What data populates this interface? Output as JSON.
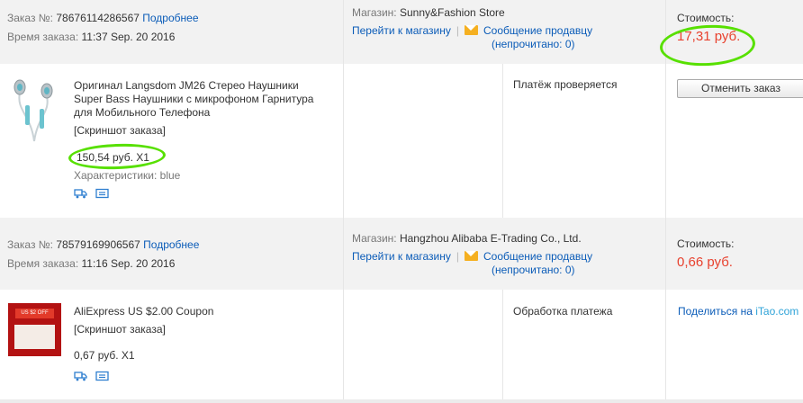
{
  "orders": [
    {
      "order_label": "Заказ №:",
      "order_number": "78676114286567",
      "details_link": "Подробнее",
      "time_label": "Время заказа:",
      "time_value": "11:37 Sep. 20 2016",
      "store_label": "Магазин:",
      "store_name": "Sunny&Fashion Store",
      "go_to_store": "Перейти к магазину",
      "separator": "|",
      "message_seller": "Сообщение продавцу",
      "unread_open": "(непрочитано:",
      "unread_count": "0",
      "unread_close": ")",
      "cost_label": "Стоимость:",
      "cost_value": "17,31 руб.",
      "product_title_1": "Оригинал Langsdom JM26 Стерео Наушники",
      "product_title_2": "Super Bass Наушники с микрофоном Гарнитура",
      "product_title_3": "для Мобильного Телефона",
      "snapshot": "[Скриншот заказа]",
      "item_price": "150,54 руб. X1",
      "attributes_label": "Характеристики:",
      "attributes_value": "blue",
      "status": "Платёж проверяется",
      "action_label": "Отменить заказ"
    },
    {
      "order_label": "Заказ №:",
      "order_number": "78579169906567",
      "details_link": "Подробнее",
      "time_label": "Время заказа:",
      "time_value": "11:16 Sep. 20 2016",
      "store_label": "Магазин:",
      "store_name": "Hangzhou Alibaba E-Trading Co., Ltd.",
      "go_to_store": "Перейти к магазину",
      "separator": "|",
      "message_seller": "Сообщение продавцу",
      "unread_open": "(непрочитано:",
      "unread_count": "0",
      "unread_close": ")",
      "cost_label": "Стоимость:",
      "cost_value": "0,66 руб.",
      "product_title_1": "AliExpress US $2.00 Coupon",
      "snapshot": "[Скриншот заказа]",
      "item_price": "0,67 руб. X1",
      "coupon_badge": "US $2 OFF",
      "status": "Обработка платежа",
      "share_label": "Поделиться на",
      "share_brand": "iTao.com"
    }
  ],
  "colors": {
    "link": "#0b5cb8",
    "price": "#e8412e",
    "header_bg": "#f2f2f2",
    "highlight": "#57e000"
  },
  "icons": [
    "truck-icon",
    "list-icon",
    "envelope-icon"
  ]
}
